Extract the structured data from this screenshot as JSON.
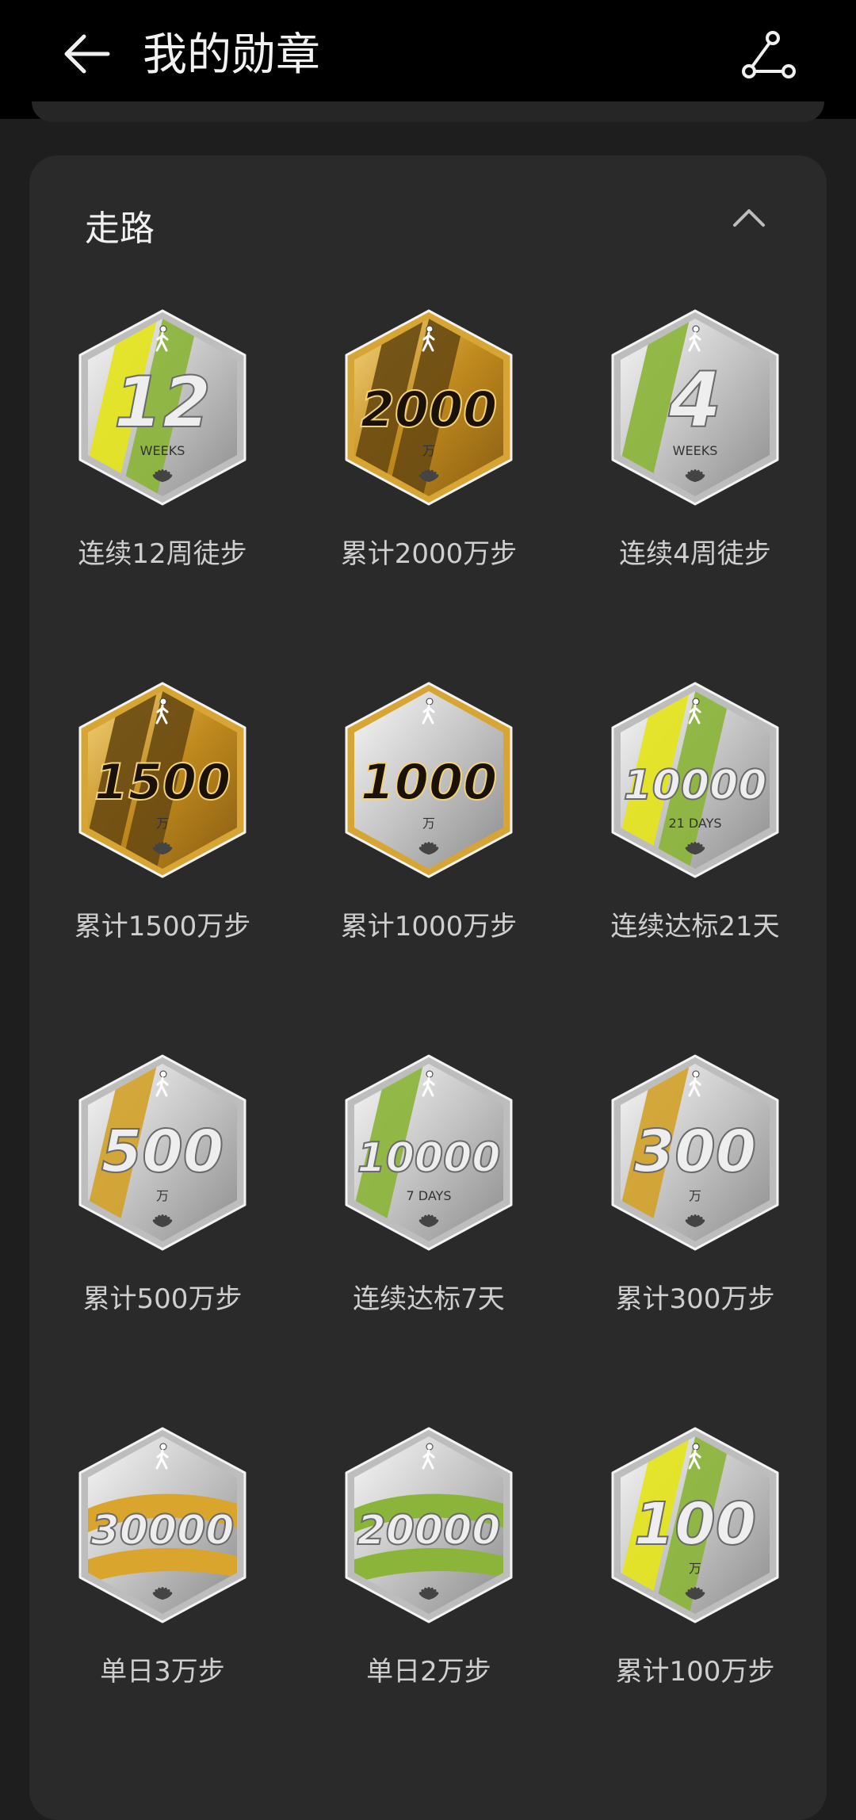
{
  "header": {
    "title": "我的勋章",
    "back_icon": "arrow-left-icon",
    "share_icon": "share-icon"
  },
  "section": {
    "title": "走路",
    "collapse_icon": "chevron-up-icon"
  },
  "colors": {
    "gold": "#c8941f",
    "silver": "#c9c9c9",
    "green": "#8fb83a",
    "yellow": "#e3e31f"
  },
  "medals": [
    {
      "number": "12",
      "sub": "WEEKS",
      "label": "连续12周徒步",
      "theme": "silver",
      "stripes": [
        "yellow",
        "green"
      ]
    },
    {
      "number": "2000",
      "sub": "万",
      "label": "累计2000万步",
      "theme": "gold",
      "stripes": [
        "dark",
        "dark"
      ]
    },
    {
      "number": "4",
      "sub": "WEEKS",
      "label": "连续4周徒步",
      "theme": "silver",
      "stripes": [
        "green"
      ]
    },
    {
      "number": "1500",
      "sub": "万",
      "label": "累计1500万步",
      "theme": "gold",
      "stripes": [
        "dark",
        "dark"
      ]
    },
    {
      "number": "1000",
      "sub": "万",
      "label": "累计1000万步",
      "theme": "silvergold",
      "stripes": []
    },
    {
      "number": "10000",
      "sub": "21 DAYS",
      "label": "连续达标21天",
      "theme": "silver",
      "stripes": [
        "yellow",
        "green"
      ]
    },
    {
      "number": "500",
      "sub": "万",
      "label": "累计500万步",
      "theme": "silver",
      "stripes": [
        "gold"
      ]
    },
    {
      "number": "10000",
      "sub": "7 DAYS",
      "label": "连续达标7天",
      "theme": "silver",
      "stripes": [
        "green"
      ]
    },
    {
      "number": "300",
      "sub": "万",
      "label": "累计300万步",
      "theme": "silver",
      "stripes": [
        "gold"
      ]
    },
    {
      "number": "30000",
      "sub": "",
      "label": "单日3万步",
      "theme": "silver",
      "stripes": [
        "goldwave"
      ]
    },
    {
      "number": "20000",
      "sub": "",
      "label": "单日2万步",
      "theme": "silver",
      "stripes": [
        "greenwave"
      ]
    },
    {
      "number": "100",
      "sub": "万",
      "label": "累计100万步",
      "theme": "silver",
      "stripes": [
        "yellow",
        "green"
      ]
    }
  ]
}
